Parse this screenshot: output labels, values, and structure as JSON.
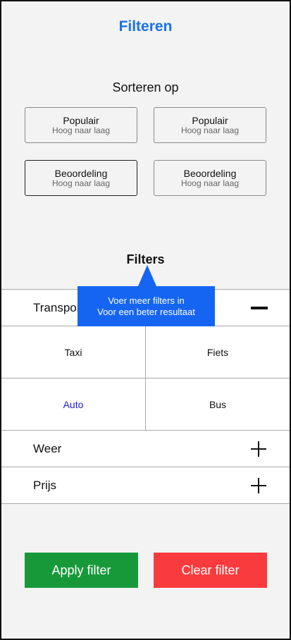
{
  "header": {
    "title": "Filteren"
  },
  "sort": {
    "title": "Sorteren op",
    "options": [
      {
        "label": "Populair",
        "sub": "Hoog naar laag"
      },
      {
        "label": "Populair",
        "sub": "Hoog naar laag"
      },
      {
        "label": "Beoordeling",
        "sub": "Hoog naar laag"
      },
      {
        "label": "Beoordeling",
        "sub": "Hoog naar laag"
      }
    ]
  },
  "filters": {
    "title": "Filters",
    "transport": {
      "label": "Transport",
      "options": [
        "Taxi",
        "Fiets",
        "Auto",
        "Bus"
      ],
      "selected": "Auto"
    },
    "weather": {
      "label": "Weer"
    },
    "price": {
      "label": "Prijs"
    }
  },
  "tooltip": {
    "line1": "Voer meer filters in",
    "line2": "Voor een beter resultaat"
  },
  "actions": {
    "apply_label": "Apply filter",
    "clear_label": "Clear filter"
  },
  "colors": {
    "title": "#1a73e8",
    "tooltip": "#1565f2",
    "apply": "#17993a",
    "clear": "#fa3b3e",
    "selected_option": "#1a1ad6"
  },
  "icons": {
    "transport_toggle": "minus-icon",
    "weather_toggle": "plus-icon",
    "price_toggle": "plus-icon"
  }
}
